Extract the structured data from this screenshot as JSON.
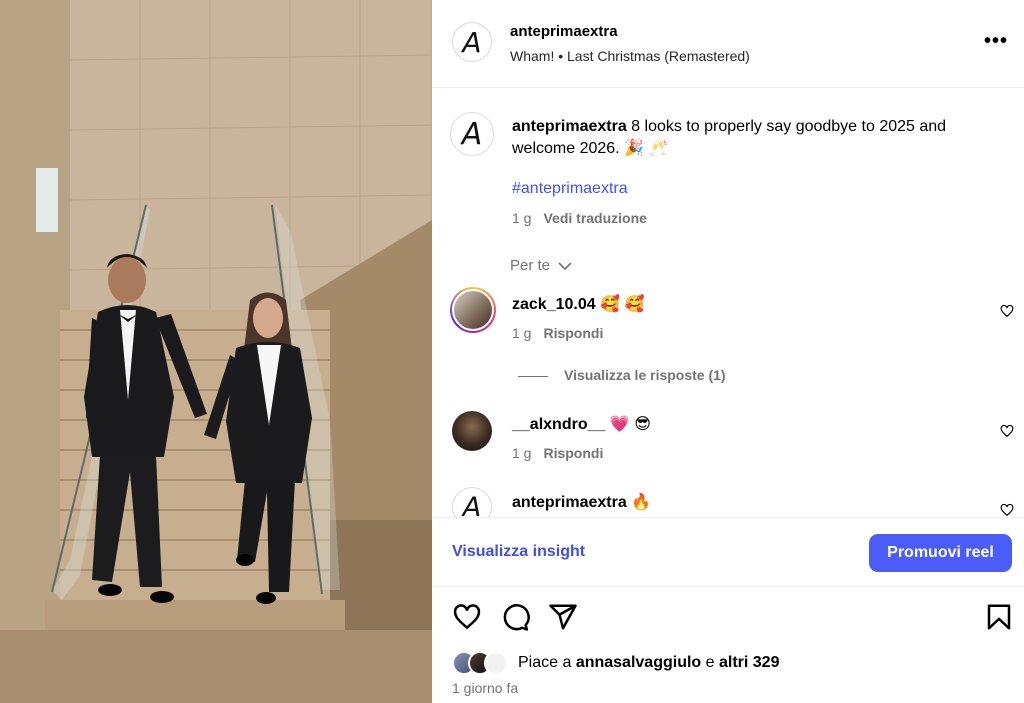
{
  "post": {
    "username": "anteprimaextra",
    "audio": "Wham! • Last Christmas (Remastered)",
    "avatar_letter": "A"
  },
  "caption": {
    "username": "anteprimaextra",
    "text": " 8 looks to properly say goodbye to 2025 and welcome 2026. 🎉 🥂",
    "hashtag": "#anteprimaextra",
    "age": "1 g",
    "translate_label": "Vedi traduzione"
  },
  "sort_label": "Per te",
  "comments": [
    {
      "username": "zack_10.04",
      "text": " 🥰 🥰",
      "age": "1 g",
      "reply_label": "Rispondi"
    },
    {
      "username": "__alxndro__",
      "text": " 💗 😎",
      "age": "1 g",
      "reply_label": "Rispondi"
    },
    {
      "username": "anteprimaextra",
      "text": " 🔥"
    }
  ],
  "view_replies_label": "Visualizza le risposte (1)",
  "insight_label": "Visualizza insight",
  "promote_label": "Promuovi reel",
  "likes": {
    "prefix": "Piace a ",
    "user": "annasalvaggiulo",
    "middle": " e ",
    "others": "altri 329"
  },
  "timestamp": "1 giorno fa",
  "icons": [
    "heart-icon",
    "comment-icon",
    "share-icon",
    "bookmark-icon",
    "more-icon"
  ],
  "colors": {
    "accent": "#4a5df9",
    "link": "#4150f7",
    "muted": "#737373"
  }
}
